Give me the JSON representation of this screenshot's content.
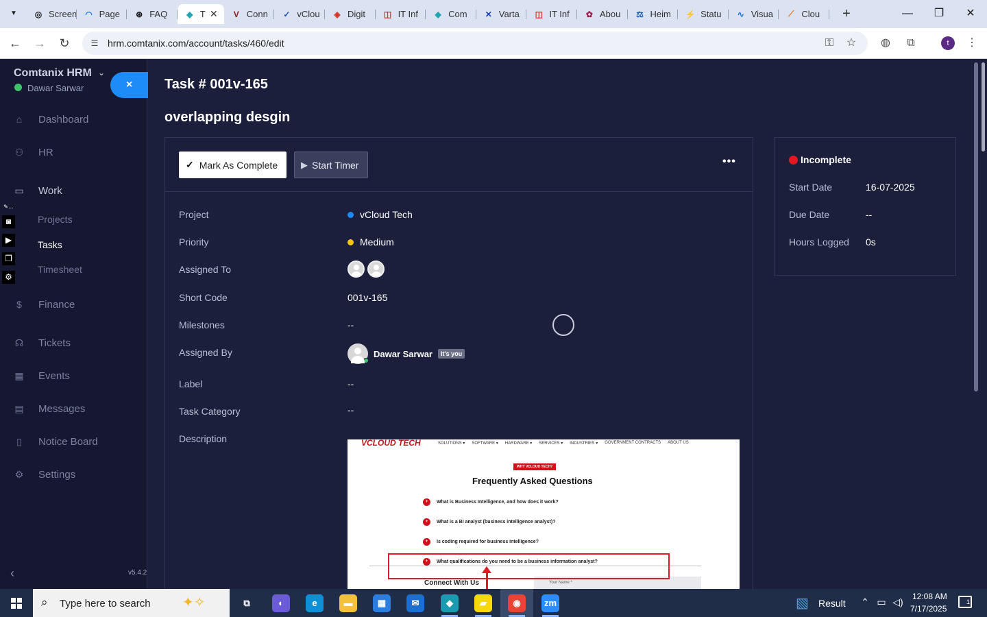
{
  "browser": {
    "tabs": [
      {
        "title": "Screen",
        "icon": "screen-recorder-icon",
        "color": "#222222",
        "glyph": "◎"
      },
      {
        "title": "Page",
        "icon": "pagespeed-icon",
        "color": "#1a73e8",
        "glyph": "◠"
      },
      {
        "title": "FAQ",
        "icon": "openai-icon",
        "color": "#111111",
        "glyph": "⊛"
      },
      {
        "title": "T",
        "icon": "comtanix-icon",
        "color": "#22a6b3",
        "glyph": "◆",
        "active": true
      },
      {
        "title": "Conn",
        "icon": "v-logo-icon",
        "color": "#8b1a1a",
        "glyph": "V"
      },
      {
        "title": "vClou",
        "icon": "vcloud-icon",
        "color": "#1a4fb8",
        "glyph": "✓"
      },
      {
        "title": "Digit",
        "icon": "digit-icon",
        "color": "#d93025",
        "glyph": "◈"
      },
      {
        "title": "IT Inf",
        "icon": "it-info-icon",
        "color": "#d93025",
        "glyph": "◫"
      },
      {
        "title": "Com",
        "icon": "comtanix-icon",
        "color": "#22a6b3",
        "glyph": "◆"
      },
      {
        "title": "Varta",
        "icon": "varta-icon",
        "color": "#1d3fbf",
        "glyph": "✕"
      },
      {
        "title": "IT Inf",
        "icon": "it-info-icon",
        "color": "#d93025",
        "glyph": "◫"
      },
      {
        "title": "Abou",
        "icon": "about-icon",
        "color": "#9c1c4a",
        "glyph": "✿"
      },
      {
        "title": "Heim",
        "icon": "scale-icon",
        "color": "#1a5fb4",
        "glyph": "⚖"
      },
      {
        "title": "Statu",
        "icon": "status-icon",
        "color": "#c2185b",
        "glyph": "⚡"
      },
      {
        "title": "Visua",
        "icon": "visual-icon",
        "color": "#1a73e8",
        "glyph": "∿"
      },
      {
        "title": "Clou",
        "icon": "cloud-icon",
        "color": "#e8710a",
        "glyph": "⟋"
      }
    ],
    "url": "hrm.comtanix.com/account/tasks/460/edit",
    "profile_initial": "t"
  },
  "sidebar": {
    "brand": "Comtanix HRM",
    "user": "Dawar Sarwar",
    "close_label": "×",
    "nav": [
      {
        "label": "Dashboard",
        "icon": "home-icon",
        "glyph": "⌂"
      },
      {
        "label": "HR",
        "icon": "users-icon",
        "glyph": "⚇"
      },
      {
        "label": "Work",
        "icon": "briefcase-icon",
        "glyph": "▭"
      },
      {
        "label": "Finance",
        "icon": "dollar-icon",
        "glyph": "$"
      },
      {
        "label": "Tickets",
        "icon": "headset-icon",
        "glyph": "☊"
      },
      {
        "label": "Events",
        "icon": "calendar-icon",
        "glyph": "▦"
      },
      {
        "label": "Messages",
        "icon": "message-icon",
        "glyph": "▤"
      },
      {
        "label": "Notice Board",
        "icon": "clipboard-icon",
        "glyph": "▯"
      },
      {
        "label": "Settings",
        "icon": "settings-icon",
        "glyph": "⚙"
      }
    ],
    "work_sub": [
      {
        "label": "Projects"
      },
      {
        "label": "Tasks",
        "active": true
      },
      {
        "label": "Timesheet"
      }
    ],
    "version": "v5.4.2"
  },
  "task": {
    "number": "Task # 001v-165",
    "heading": "overlapping desgin",
    "mark_complete_label": "Mark As Complete",
    "start_timer_label": "Start Timer",
    "fields": {
      "project_label": "Project",
      "project_value": "vCloud Tech",
      "project_color": "#1d8cf8",
      "priority_label": "Priority",
      "priority_value": "Medium",
      "priority_color": "#f5c518",
      "assigned_to_label": "Assigned To",
      "short_code_label": "Short Code",
      "short_code_value": "001v-165",
      "milestones_label": "Milestones",
      "milestones_value": "--",
      "assigned_by_label": "Assigned By",
      "assigned_by_value": "Dawar Sarwar",
      "its_you": "It's you",
      "label_label": "Label",
      "label_value": "--",
      "category_label": "Task Category",
      "category_value": "--",
      "description_label": "Description"
    },
    "description_image": {
      "logo": "VCLOUD TECH",
      "menu": [
        "SOLUTIONS ▾",
        "SOFTWARE ▾",
        "HARDWARE ▾",
        "SERVICES ▾",
        "INDUSTRIES ▾",
        "GOVERNMENT CONTRACTS",
        "ABOUT US"
      ],
      "badge": "WHY VCLOUD TECH?",
      "heading": "Frequently Asked Questions",
      "questions": [
        "What is Business Intelligence, and how does it work?",
        "What is a BI analyst (business intelligence analyst)?",
        "Is coding required for business intelligence?",
        "What qualifications do you need to be a business information analyst?"
      ],
      "connect": "Connect With Us",
      "your_name": "Your Name *"
    }
  },
  "status": {
    "text": "Incomplete",
    "color": "#e0181f",
    "start_date_label": "Start Date",
    "start_date_value": "16-07-2025",
    "due_date_label": "Due Date",
    "due_date_value": "--",
    "hours_label": "Hours Logged",
    "hours_value": "0s"
  },
  "taskbar": {
    "search_placeholder": "Type here to search",
    "weather": "Result",
    "time": "12:08 AM",
    "date": "7/17/2025",
    "notification_count": "1",
    "apps": [
      {
        "name": "task-view-icon",
        "glyph": "⧉",
        "bg": "transparent"
      },
      {
        "name": "copilot-icon",
        "glyph": "◐",
        "bg": "#6b5bd6"
      },
      {
        "name": "edge-icon",
        "glyph": "e",
        "bg": "#0f8fd6"
      },
      {
        "name": "file-explorer-icon",
        "glyph": "▬",
        "bg": "#f3c13a"
      },
      {
        "name": "store-icon",
        "glyph": "▦",
        "bg": "#2b7de0"
      },
      {
        "name": "mail-icon",
        "glyph": "✉",
        "bg": "#1a6fd0"
      },
      {
        "name": "app-icon",
        "glyph": "◆",
        "bg": "#1c9ab0"
      },
      {
        "name": "sticky-notes-icon",
        "glyph": "▰",
        "bg": "#f5d90a"
      },
      {
        "name": "chrome-icon",
        "glyph": "◉",
        "bg": "#e84335"
      },
      {
        "name": "zoom-icon",
        "glyph": "zm",
        "bg": "#2d8cff"
      }
    ]
  }
}
